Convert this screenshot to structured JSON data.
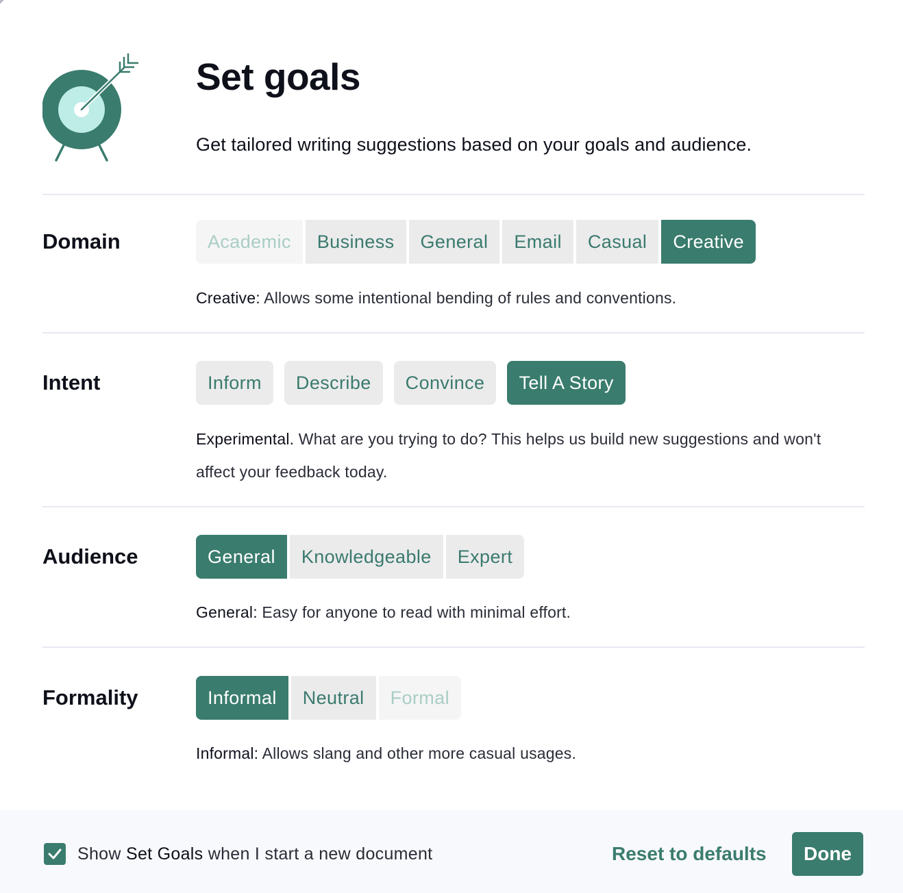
{
  "header": {
    "title": "Set goals",
    "subtitle": "Get tailored writing suggestions based on your goals and audience.",
    "icon": "target-with-arrow-icon"
  },
  "colors": {
    "accent": "#3a7c6e",
    "accent_light": "#bdede6",
    "option_bg": "#ebebeb",
    "option_disabled_bg": "#f5f5f5",
    "option_disabled_text": "#a9cdc5",
    "divider": "#e7e9f3",
    "footer_bg": "#f8f9fd"
  },
  "sections": {
    "domain": {
      "label": "Domain",
      "options": [
        {
          "label": "Academic",
          "state": "disabled"
        },
        {
          "label": "Business",
          "state": "default"
        },
        {
          "label": "General",
          "state": "default"
        },
        {
          "label": "Email",
          "state": "default"
        },
        {
          "label": "Casual",
          "state": "default"
        },
        {
          "label": "Creative",
          "state": "selected"
        }
      ],
      "description_lead": "Creative:",
      "description_body": " Allows some intentional bending of rules and conventions."
    },
    "intent": {
      "label": "Intent",
      "options": [
        {
          "label": "Inform",
          "state": "default"
        },
        {
          "label": "Describe",
          "state": "default"
        },
        {
          "label": "Convince",
          "state": "default"
        },
        {
          "label": "Tell A Story",
          "state": "selected"
        }
      ],
      "description_lead": "Experimental.",
      "description_body": " What are you trying to do? This helps us build new suggestions and won't affect your feedback today."
    },
    "audience": {
      "label": "Audience",
      "options": [
        {
          "label": "General",
          "state": "selected"
        },
        {
          "label": "Knowledgeable",
          "state": "default"
        },
        {
          "label": "Expert",
          "state": "default"
        }
      ],
      "description_lead": "General:",
      "description_body": " Easy for anyone to read with minimal effort."
    },
    "formality": {
      "label": "Formality",
      "options": [
        {
          "label": "Informal",
          "state": "selected"
        },
        {
          "label": "Neutral",
          "state": "default"
        },
        {
          "label": "Formal",
          "state": "disabled"
        }
      ],
      "description_lead": "Informal:",
      "description_body": " Allows slang and other more casual usages."
    }
  },
  "footer": {
    "checkbox_checked": true,
    "checkbox_label_prefix": "Show ",
    "checkbox_label_strong": "Set Goals",
    "checkbox_label_suffix": " when I start a new document",
    "reset_label": "Reset to defaults",
    "done_label": "Done"
  }
}
